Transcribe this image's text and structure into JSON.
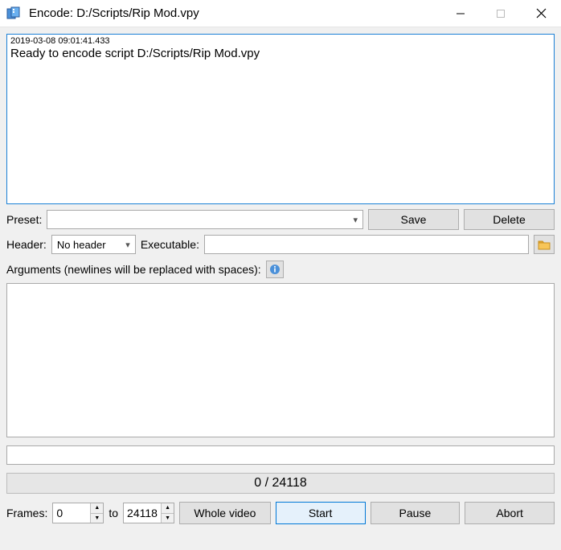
{
  "window": {
    "title": "Encode: D:/Scripts/Rip Mod.vpy"
  },
  "log": {
    "timestamp": "2019-03-08 09:01:41.433",
    "message": "Ready to encode script D:/Scripts/Rip Mod.vpy"
  },
  "preset": {
    "label": "Preset:",
    "value": "",
    "save": "Save",
    "delete": "Delete"
  },
  "header": {
    "label": "Header:",
    "selected": "No header",
    "exec_label": "Executable:",
    "exec_value": ""
  },
  "arguments": {
    "label": "Arguments (newlines will be replaced with spaces):",
    "value": ""
  },
  "commandline": {
    "value": ""
  },
  "progress": {
    "text": "0 / 24118"
  },
  "frames": {
    "label": "Frames:",
    "from": "0",
    "to_label": "to",
    "to": "24118",
    "whole": "Whole video",
    "start": "Start",
    "pause": "Pause",
    "abort": "Abort"
  }
}
